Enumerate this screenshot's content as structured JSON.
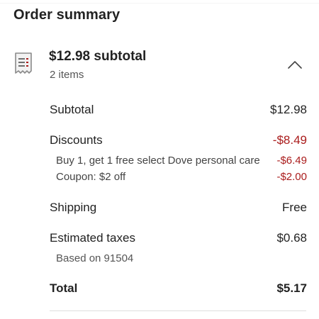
{
  "title": "Order summary",
  "summary": {
    "heading": "$12.98 subtotal",
    "items_count": "2 items",
    "expanded": true
  },
  "rows": {
    "subtotal": {
      "label": "Subtotal",
      "value": "$12.98"
    },
    "discounts": {
      "label": "Discounts",
      "value": "-$8.49"
    },
    "discount_items": [
      {
        "label": "Buy 1, get 1 free select Dove personal care",
        "value": "-$6.49"
      },
      {
        "label": "Coupon: $2 off",
        "value": "-$2.00"
      }
    ],
    "shipping": {
      "label": "Shipping",
      "value": "Free"
    },
    "taxes": {
      "label": "Estimated taxes",
      "value": "$0.68",
      "note": "Based on 91504"
    },
    "total": {
      "label": "Total",
      "value": "$5.17"
    }
  },
  "colors": {
    "discount_red": "#aa1c1c",
    "text": "#222222",
    "icon_gray": "#8a8a8a"
  },
  "icons": {
    "receipt": "receipt-icon",
    "chevron": "chevron-up-icon"
  }
}
